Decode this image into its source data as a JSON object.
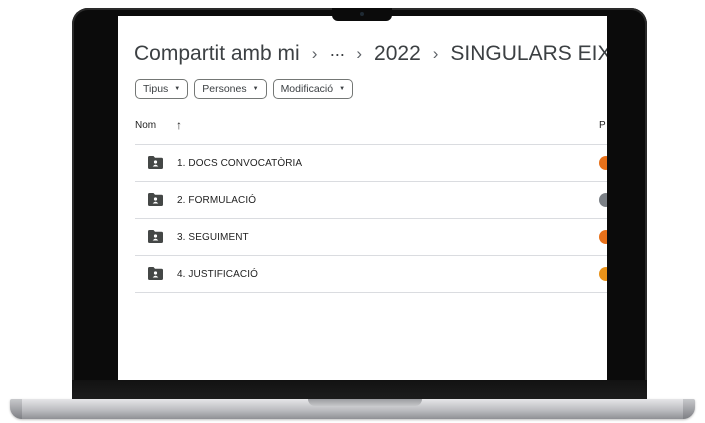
{
  "breadcrumb": {
    "root": "Compartit amb mi",
    "separator": "›",
    "ellipsis": "···",
    "year": "2022",
    "current": "SINGULARS EIX E",
    "caret": "▾"
  },
  "filters": [
    {
      "label": "Tipus",
      "icon": "▼"
    },
    {
      "label": "Persones",
      "icon": "▼"
    },
    {
      "label": "Modificació",
      "icon": "▼"
    }
  ],
  "table": {
    "name_header": "Nom",
    "sort_icon": "↑",
    "owner_header": "P"
  },
  "folders": [
    {
      "name": "1. DOCS CONVOCATÒRIA",
      "owner_color": "#e8711a"
    },
    {
      "name": "2. FORMULACIÓ",
      "owner_color": "#7a7f85"
    },
    {
      "name": "3. SEGUIMENT",
      "owner_color": "#e8711a"
    },
    {
      "name": "4. JUSTIFICACIÓ",
      "owner_color": "#e8921a"
    }
  ]
}
